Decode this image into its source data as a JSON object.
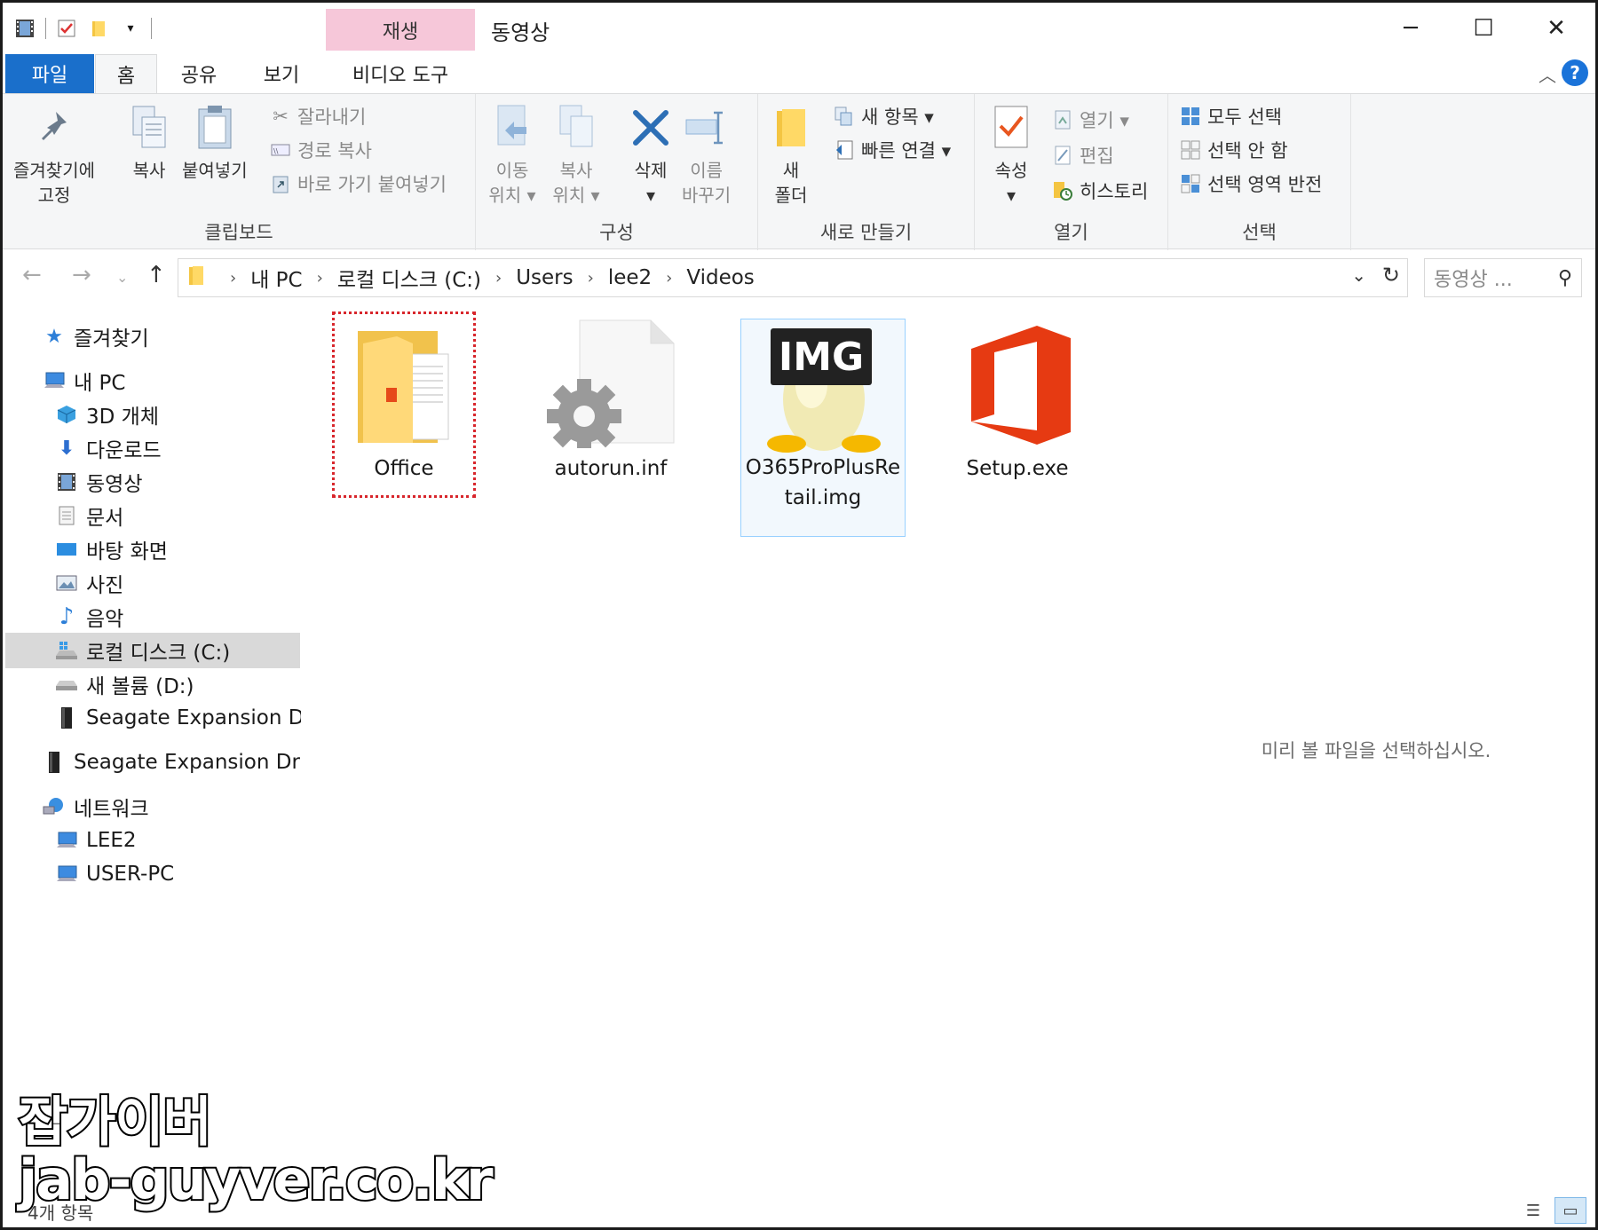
{
  "titlebar": {
    "context_tab_group": "재생",
    "title": "동영상",
    "qat_icons": [
      "film-icon",
      "checkbox-icon",
      "folder-icon",
      "dropdown-icon"
    ]
  },
  "tabs": {
    "file": "파일",
    "home": "홈",
    "share": "공유",
    "view": "보기",
    "video_tools": "비디오 도구"
  },
  "ribbon": {
    "clipboard": {
      "label": "클립보드",
      "pin": "즐겨찾기에\n고정",
      "copy": "복사",
      "paste": "붙여넣기",
      "cut": "잘라내기",
      "copy_path": "경로 복사",
      "paste_shortcut": "바로 가기 붙여넣기"
    },
    "organize": {
      "label": "구성",
      "move_to": "이동\n위치 ▾",
      "copy_to": "복사\n위치 ▾",
      "delete": "삭제\n▾",
      "rename": "이름\n바꾸기"
    },
    "new": {
      "label": "새로 만들기",
      "new_folder": "새\n폴더",
      "new_item": "새 항목 ▾",
      "easy_access": "빠른 연결 ▾"
    },
    "open": {
      "label": "열기",
      "properties": "속성\n▾",
      "open": "열기 ▾",
      "edit": "편집",
      "history": "히스토리"
    },
    "select": {
      "label": "선택",
      "select_all": "모두 선택",
      "select_none": "선택 안 함",
      "invert": "선택 영역 반전"
    }
  },
  "address": {
    "breadcrumbs": [
      "내 PC",
      "로컬 디스크 (C:)",
      "Users",
      "lee2",
      "Videos"
    ],
    "search_placeholder": "동영상 ..."
  },
  "navpane": {
    "items": [
      {
        "label": "즐겨찾기",
        "icon": "star-icon"
      },
      {
        "label": "내 PC",
        "icon": "computer-icon"
      },
      {
        "label": "3D 개체",
        "icon": "cube-icon"
      },
      {
        "label": "다운로드",
        "icon": "download-icon"
      },
      {
        "label": "동영상",
        "icon": "film-icon"
      },
      {
        "label": "문서",
        "icon": "document-icon"
      },
      {
        "label": "바탕 화면",
        "icon": "desktop-icon"
      },
      {
        "label": "사진",
        "icon": "picture-icon"
      },
      {
        "label": "음악",
        "icon": "music-icon"
      },
      {
        "label": "로컬 디스크 (C:)",
        "icon": "windows-drive-icon"
      },
      {
        "label": "새 볼륨 (D:)",
        "icon": "drive-icon"
      },
      {
        "label": "Seagate Expansion Dr",
        "icon": "external-drive-icon"
      },
      {
        "label": "Seagate Expansion Driv",
        "icon": "external-drive-icon"
      },
      {
        "label": "네트워크",
        "icon": "network-icon"
      },
      {
        "label": "LEE2",
        "icon": "computer-icon"
      },
      {
        "label": "USER-PC",
        "icon": "computer-icon"
      }
    ]
  },
  "files": [
    {
      "name": "Office",
      "type": "folder"
    },
    {
      "name": "autorun.inf",
      "type": "settings-file"
    },
    {
      "name": "O365ProPlusRe\ntail.img",
      "type": "disc-image",
      "badge": "IMG"
    },
    {
      "name": "Setup.exe",
      "type": "office-exe"
    }
  ],
  "preview": {
    "message": "미리 볼 파일을 선택하십시오."
  },
  "status": {
    "count": "4개 항목"
  },
  "watermark": {
    "line1": "잡가이버",
    "line2": "jab-guyver.co.kr"
  },
  "colors": {
    "file_tab": "#1a6fcb",
    "context_tab": "#f6c7d9",
    "office_red": "#e64a19",
    "selection": "#d9d9d9",
    "highlight": "#d8262c"
  }
}
